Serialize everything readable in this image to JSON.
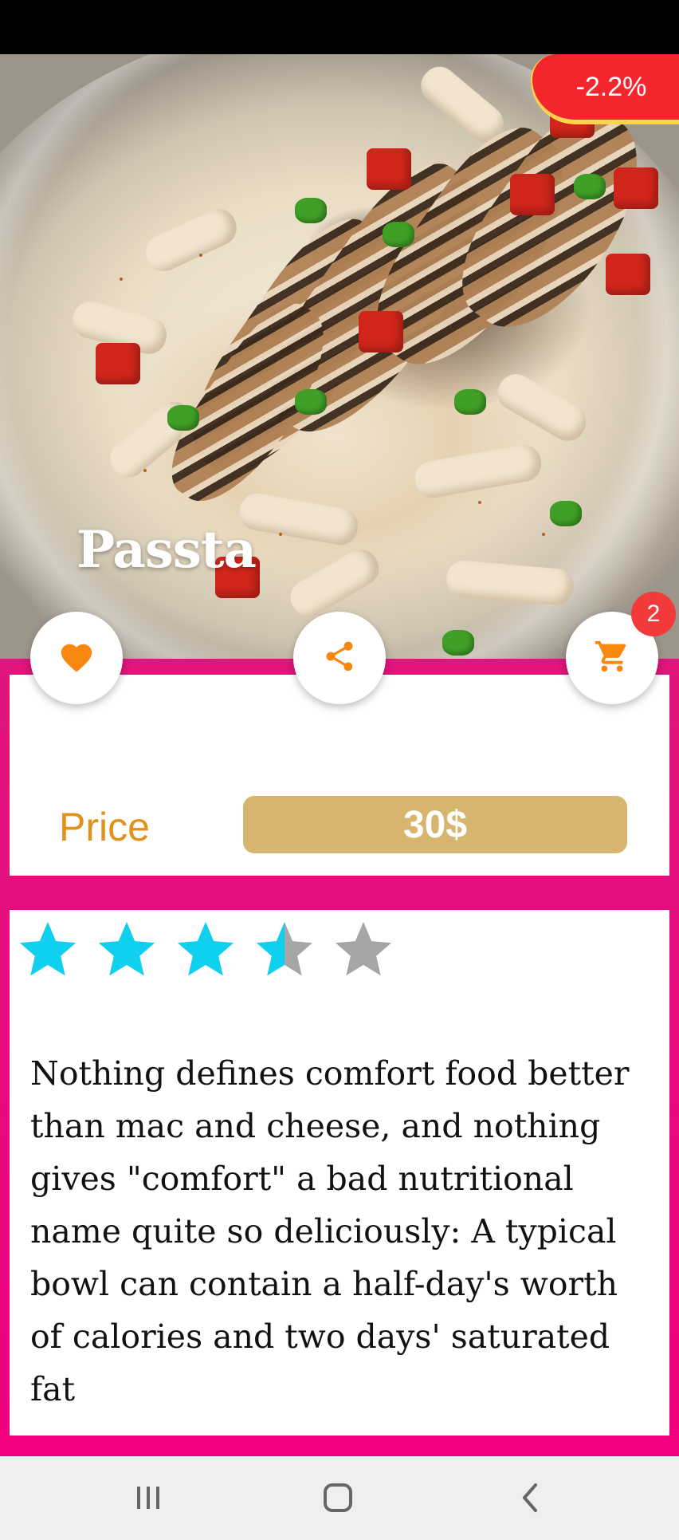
{
  "discount_badge": "-2.2%",
  "dish": {
    "title": "Passta"
  },
  "actions": {
    "favorite_icon": "heart-icon",
    "share_icon": "share-icon",
    "cart_icon": "cart-icon",
    "cart_count": "2"
  },
  "price": {
    "label": "Price",
    "value": "30$"
  },
  "rating": {
    "value": 3.5,
    "max": 5
  },
  "description": "Nothing defines comfort food better than mac and cheese, and nothing gives \"comfort\" a bad nutritional name quite so deliciously: A typical bowl can contain a half-day's worth of calories and two days' saturated fat",
  "colors": {
    "accent_orange": "#f7870f",
    "background_pink": "#e8127f",
    "price_pill": "#d8b56e",
    "star_filled": "#10d0f0",
    "star_empty": "#a6a6a6",
    "badge_red": "#f4262d"
  },
  "nav": {
    "recents_icon": "recents-icon",
    "home_icon": "home-icon",
    "back_icon": "back-icon"
  }
}
